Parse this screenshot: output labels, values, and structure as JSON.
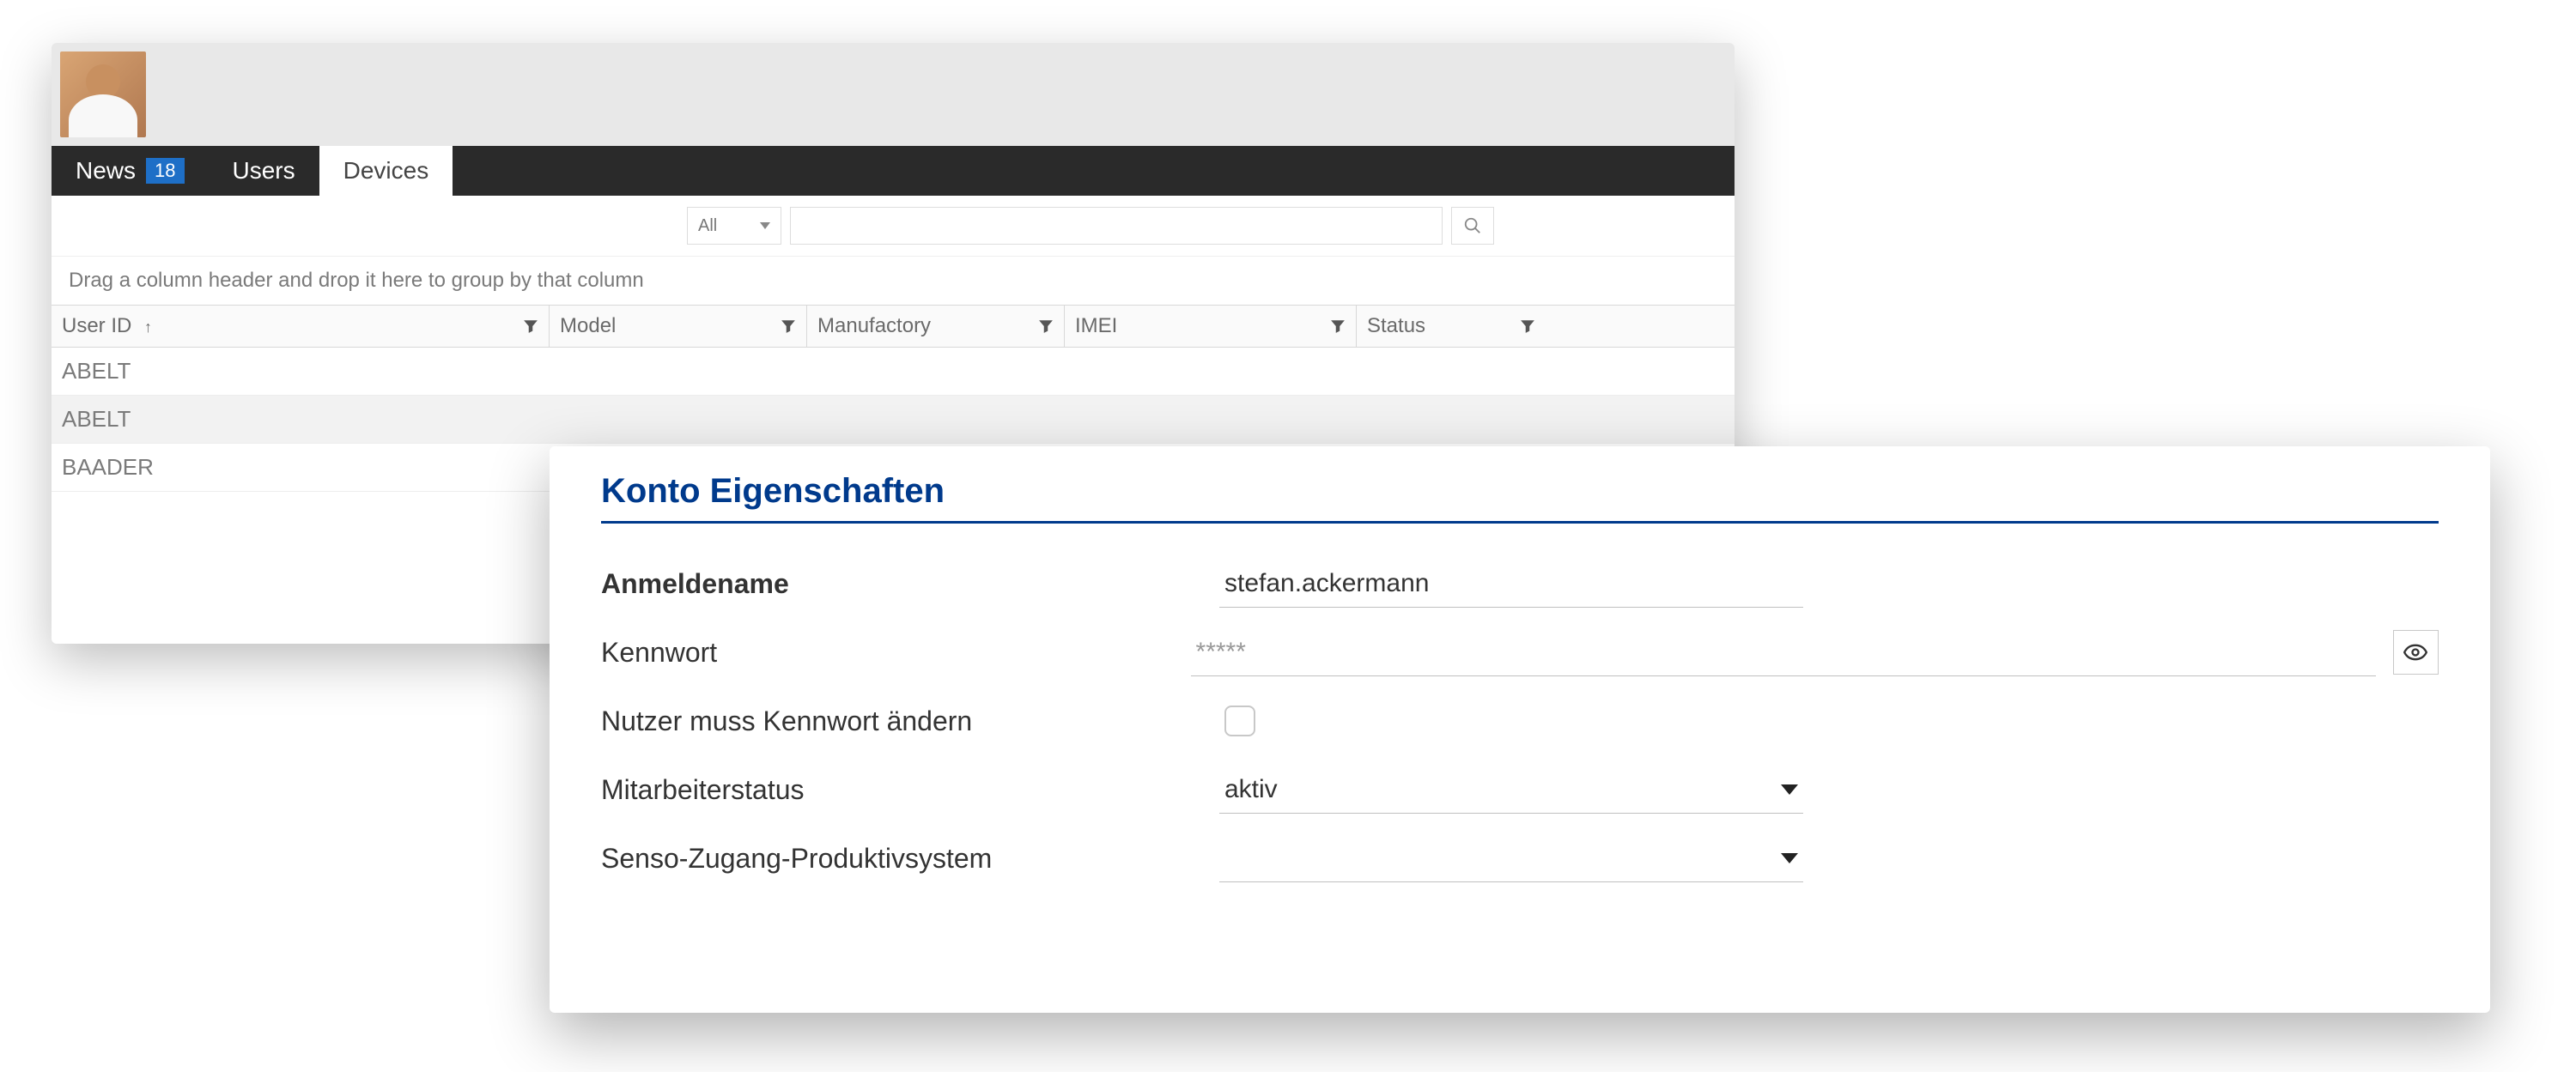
{
  "tabs": {
    "news": {
      "label": "News",
      "badge": "18"
    },
    "users": {
      "label": "Users"
    },
    "devices": {
      "label": "Devices"
    }
  },
  "filter": {
    "all": "All",
    "search_placeholder": ""
  },
  "group_hint": "Drag a column header and drop it here to group by that column",
  "columns": {
    "userid": "User ID",
    "model": "Model",
    "manuf": "Manufactory",
    "imei": "IMEI",
    "status": "Status"
  },
  "rows": [
    "ABELT",
    "ABELT",
    "BAADER"
  ],
  "panel": {
    "title": "Konto Eigenschaften",
    "username_label": "Anmeldename",
    "username_value": "stefan.ackermann",
    "password_label": "Kennwort",
    "password_value": "*****",
    "mustchange_label": "Nutzer muss Kennwort ändern",
    "status_label": "Mitarbeiterstatus",
    "status_value": "aktiv",
    "senso_label": "Senso-Zugang-Produktivsystem",
    "senso_value": ""
  }
}
